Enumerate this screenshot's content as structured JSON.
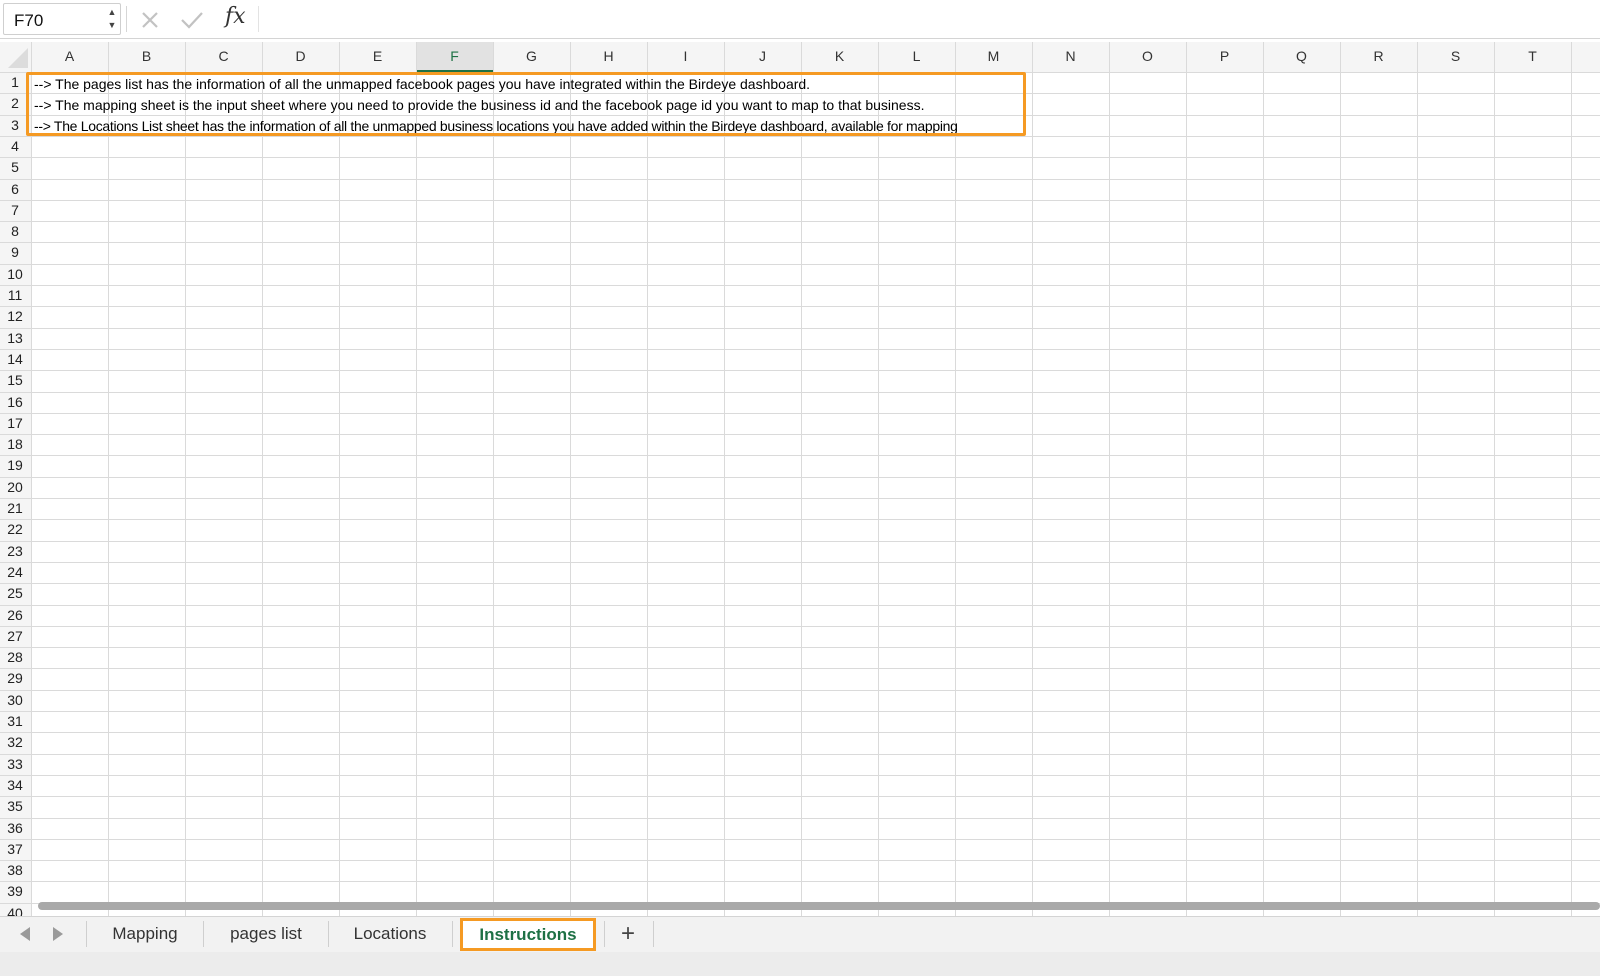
{
  "formula_bar": {
    "name_box": "F70",
    "name_box_stepper": "▲▼",
    "cancel_icon": "close-x-icon",
    "enter_icon": "checkmark-icon",
    "function_label": "fx",
    "formula": ""
  },
  "columns": [
    "A",
    "B",
    "C",
    "D",
    "E",
    "F",
    "G",
    "H",
    "I",
    "J",
    "K",
    "L",
    "M",
    "N",
    "O",
    "P",
    "Q",
    "R",
    "S",
    "T"
  ],
  "selected_column": "F",
  "rows": [
    "1",
    "2",
    "3",
    "4",
    "5",
    "6",
    "7",
    "8",
    "9",
    "10",
    "11",
    "12",
    "13",
    "14",
    "15",
    "16",
    "17",
    "18",
    "19",
    "20",
    "21",
    "22",
    "23",
    "24",
    "25",
    "26",
    "27",
    "28",
    "29",
    "30",
    "31",
    "32",
    "33",
    "34",
    "35",
    "36",
    "37",
    "38",
    "39",
    "40"
  ],
  "cells": {
    "A1": "--> The pages list has the information of all the unmapped facebook pages you have integrated within the Birdeye dashboard.",
    "A2": "--> The mapping sheet is the input sheet where you need to provide the business id and the facebook page id you want to map to that business.",
    "A3": "--> The Locations List sheet has the information of all the unmapped business locations you have added within the Birdeye dashboard, available for mapping"
  },
  "tabs": {
    "mapping": "Mapping",
    "pages_list": "pages list",
    "locations": "Locations",
    "instructions": "Instructions",
    "add": "+"
  },
  "active_tab": "Instructions",
  "colors": {
    "highlight": "#f59a23",
    "active_tab_text": "#1e7145",
    "gridline": "#dadada"
  }
}
